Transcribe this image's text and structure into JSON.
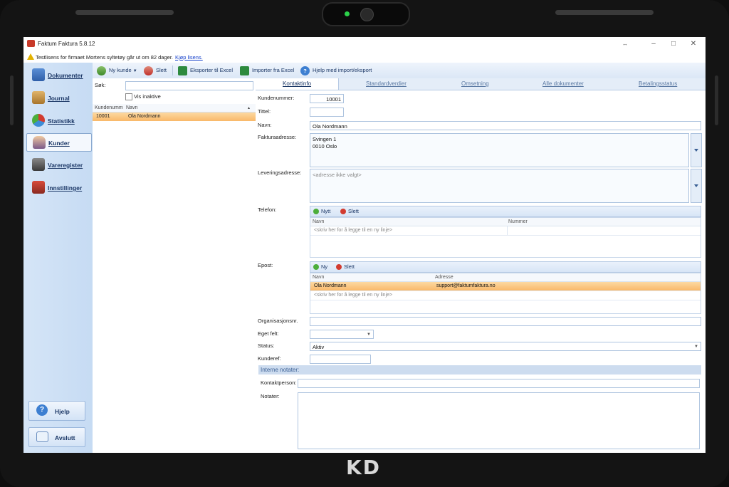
{
  "device": {
    "brand": "KD"
  },
  "window": {
    "title": "Faktum Faktura 5.8.12",
    "notice_text": "Testlisens for firmaet Mortens syltetøy går ut om 82 dager.",
    "notice_link": "Kjøp lisens."
  },
  "nav": {
    "items": [
      "Dokumenter",
      "Journal",
      "Statistikk",
      "Kunder",
      "Vareregister",
      "Innstillinger"
    ],
    "active": "Kunder",
    "help": "Hjelp",
    "exit": "Avslutt"
  },
  "toolbar": {
    "new": "Ny kunde",
    "delete": "Slett",
    "export": "Eksporter til Excel",
    "import": "Importer fra Excel",
    "help": "Hjelp med import/eksport"
  },
  "list": {
    "search_label": "Søk:",
    "search_value": "",
    "show_inactive": "Vis inaktive",
    "columns": [
      "Kundenumm",
      "Navn"
    ],
    "rows": [
      {
        "number": "10001",
        "name": "Ola Nordmann"
      }
    ]
  },
  "tabs": [
    "Kontaktinfo",
    "Standardverdier",
    "Omsetning",
    "Alle dokumenter",
    "Betalingsstatus"
  ],
  "form": {
    "customer_number_label": "Kundenummer:",
    "customer_number": "10001",
    "title_label": "Tittel:",
    "title_value": "",
    "name_label": "Navn:",
    "name_value": "Ola Nordmann",
    "invoice_address_label": "Fakturaadresse:",
    "invoice_address_line1": "Svingen 1",
    "invoice_address_line2": "0010 Oslo",
    "delivery_address_label": "Leveringsadresse:",
    "delivery_address_placeholder": "<adresse ikke valgt>",
    "phone_label": "Telefon:",
    "phone_new": "Nytt",
    "phone_delete": "Slett",
    "phone_columns": [
      "Navn",
      "Nummer"
    ],
    "add_row_hint": "<skriv her for å legge til en ny linje>",
    "email_label": "Epost:",
    "email_new": "Ny",
    "email_delete": "Slett",
    "email_columns": [
      "Navn",
      "Adresse"
    ],
    "email_rows": [
      {
        "name": "Ola Nordmann",
        "address": "support@faktumfaktura.no"
      }
    ],
    "org_label": "Organisasjonsnr.",
    "org_value": "",
    "custom_label": "Eget felt:",
    "custom_value": "",
    "status_label": "Status:",
    "status_value": "Aktiv",
    "ref_label": "Kunderef:",
    "ref_value": "",
    "internal_notes_label": "Interne notater:",
    "contact_person_label": "Kontaktperson:",
    "contact_person_value": "",
    "notes_label": "Notater:",
    "notes_value": ""
  },
  "colors": {
    "accent": "#1b3766",
    "selection": "#f9b86a",
    "nav_bg": "#c6dbf3"
  }
}
